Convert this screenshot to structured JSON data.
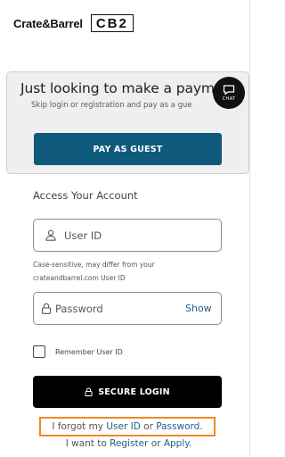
{
  "header": {
    "brand_primary": "Crate&Barrel",
    "brand_secondary": "CB2"
  },
  "guest": {
    "title": "Just looking to make a payme",
    "subtitle": "Skip login or registration and pay as a gue",
    "pay_button_label": "PAY AS GUEST"
  },
  "chat": {
    "label": "CHAT",
    "icon": "chat-bubble-icon"
  },
  "login": {
    "section_title": "Access Your Account",
    "userid_placeholder": "User ID",
    "userid_icon": "person-icon",
    "hint_line1": "Case-sensitive, may differ from your",
    "hint_line2": "crateandbarrel.com User ID",
    "password_placeholder": "Password",
    "password_icon": "lock-icon",
    "show_label": "Show",
    "remember_label": "Remember User ID",
    "remember_checked": false,
    "secure_button_label": "SECURE LOGIN",
    "secure_button_icon": "lock-icon"
  },
  "help": {
    "forgot_prefix": "I forgot my",
    "forgot_userid": "User ID",
    "forgot_or": "or",
    "forgot_password": "Password.",
    "register_prefix": "I want to",
    "register_link": "Register",
    "register_or": "or",
    "apply_link": "Apply."
  },
  "colors": {
    "guest_button": "#0f5a7c",
    "secure_button": "#000000",
    "link": "#1f5f8b",
    "highlight_outline": "#f08a24",
    "panel_background": "#efefef"
  }
}
